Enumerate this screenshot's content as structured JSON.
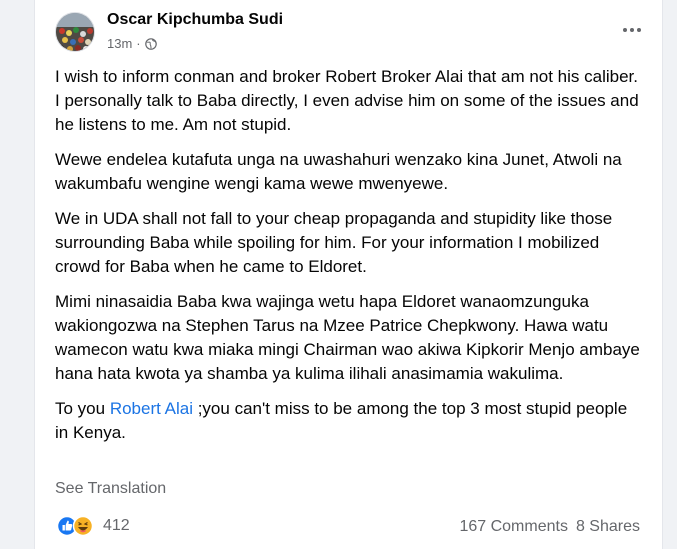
{
  "post": {
    "author": "Oscar Kipchumba Sudi",
    "time": "13m",
    "separator": "·",
    "privacy_icon": "globe-icon",
    "paragraphs": [
      "I wish to inform conman and broker Robert Broker Alai that am not his caliber. I personally talk to Baba directly, I even advise him on some of the issues and he listens to me. Am not stupid.",
      "Wewe endelea kutafuta unga na uwashahuri wenzako kina Junet, Atwoli na wakumbafu wengine wengi kama wewe mwenyewe.",
      "We in UDA shall not fall to your cheap propaganda and stupidity like those surrounding Baba while spoiling for him. For your information I mobilized crowd for Baba when he came to Eldoret.",
      "Mimi ninasaidia Baba kwa wajinga wetu hapa Eldoret wanaomzunguka wakiongozwa na Stephen Tarus na Mzee Patrice Chepkwony. Hawa watu wamecon watu kwa miaka mingi Chairman wao akiwa Kipkorir Menjo ambaye hana hata kwota ya shamba ya kulima ilihali anasimamia wakulima."
    ],
    "last_paragraph": {
      "prefix": "To you ",
      "mention": "Robert Alai",
      "suffix": " ;you can't miss to be among the top 3 most stupid people in Kenya."
    },
    "see_translation": "See Translation",
    "reactions": {
      "icons": [
        "like-icon",
        "haha-icon"
      ],
      "count": "412"
    },
    "comments": "167 Comments",
    "shares": "8 Shares"
  },
  "colors": {
    "background": "#f0f2f5",
    "card": "#ffffff",
    "link": "#1b74e4",
    "secondary_text": "#65676b",
    "like_blue": "#1877f2",
    "haha_yellow": "#f7b125"
  }
}
